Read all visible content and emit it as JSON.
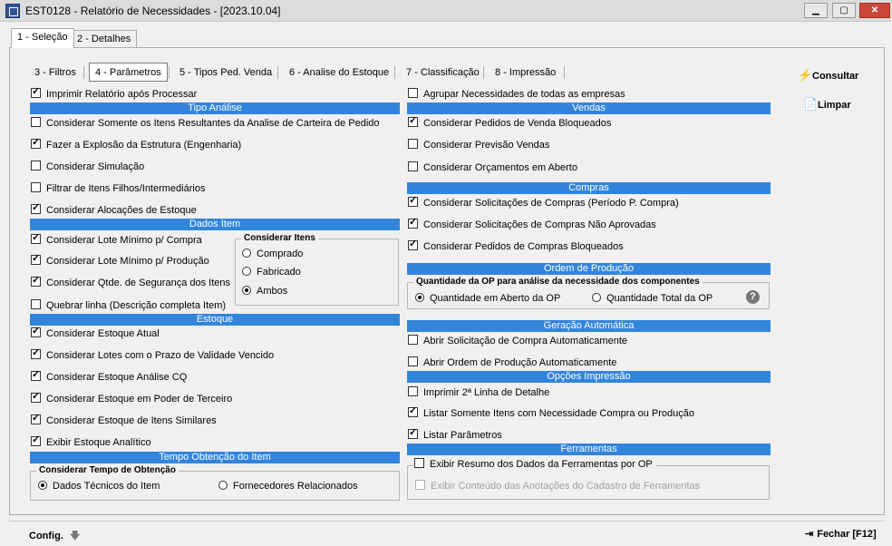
{
  "window": {
    "title": "EST0128 - Relatório de Necessidades - [2023.10.04]",
    "minimize": "▁",
    "maximize": "▢",
    "close": "✕"
  },
  "outer_tabs": [
    "1 - Seleção",
    "2 - Detalhes"
  ],
  "inner_tabs": [
    "3 - Filtros",
    "4 - Parâmetros",
    "5 - Tipos Ped. Venda",
    "6 - Analise do Estoque",
    "7 - Classificação",
    "8 - Impressão"
  ],
  "side_buttons": {
    "consultar": "Consultar",
    "consultar_icon": "⚡",
    "limpar": "Limpar",
    "limpar_icon": "📄"
  },
  "left": {
    "imprimir_relatorio": "Imprimir Relatório após Processar",
    "tipo_analise_header": "Tipo Análise",
    "tipo_analise": [
      "Considerar Somente os Itens Resultantes da Analise de Carteira de Pedido",
      "Fazer a Explosão da Estrutura (Engenharia)",
      "Considerar Simulação",
      "Filtrar de Itens Filhos/Intermediários",
      "Considerar Alocações de Estoque"
    ],
    "dados_item_header": "Dados Item",
    "dados_item": [
      "Considerar Lote Mínimo p/ Compra",
      "Considerar Lote Mínimo p/ Produção",
      "Considerar Qtde. de Segurança dos Itens",
      "Quebrar linha (Descrição completa Item)"
    ],
    "considerar_itens": {
      "title": "Considerar Itens",
      "options": [
        "Comprado",
        "Fabricado",
        "Ambos"
      ],
      "selected": "Ambos"
    },
    "estoque_header": "Estoque",
    "estoque": [
      "Considerar Estoque Atual",
      "Considerar Lotes com o Prazo de Validade Vencido",
      "Considerar Estoque Análise CQ",
      "Considerar Estoque em Poder de Terceiro",
      "Considerar Estoque de Itens Similares",
      "Exibir Estoque Analítico"
    ],
    "tempo_header": "Tempo Obtenção do Item",
    "tempo_group": {
      "title": "Considerar Tempo de Obtenção",
      "options": [
        "Dados Técnicos do Item",
        "Fornecedores Relacionados"
      ],
      "selected": "Dados Técnicos do Item"
    }
  },
  "right": {
    "agrupar": "Agrupar Necessidades de todas as empresas",
    "vendas_header": "Vendas",
    "vendas": [
      "Considerar Pedidos de Venda Bloqueados",
      "Considerar Previsão Vendas",
      "Considerar Orçamentos em Aberto"
    ],
    "compras_header": "Compras",
    "compras": [
      "Considerar Solicitações de Compras (Período P. Compra)",
      "Considerar Solicitações de Compras Não Aprovadas",
      "Considerar Pedidos de Compras Bloqueados"
    ],
    "ordem_header": "Ordem de Produção",
    "ordem_group": {
      "title": "Quantidade da OP para análise da necessidade dos componentes",
      "options": [
        "Quantidade em Aberto da OP",
        "Quantidade Total da OP"
      ],
      "selected": "Quantidade em Aberto da OP",
      "help": "?"
    },
    "geracao_header": "Geração Automática",
    "geracao": [
      "Abrir Solicitação de Compra Automaticamente",
      "Abrir Ordem de Produção Automaticamente"
    ],
    "opcoes_header": "Opções Impressão",
    "opcoes": [
      "Imprimir 2ª Linha de Detalhe",
      "Listar Somente Itens com Necessidade Compra ou Produção",
      "Listar Parâmetros"
    ],
    "ferramentas_header": "Ferramentas",
    "ferramentas_group_title": "Exibir Resumo dos Dados da Ferramentas por OP",
    "ferramentas_sub": "Exibir Conteúdo das Anotações do Cadastro de Ferramentas"
  },
  "footer": {
    "config": "Config.",
    "config_icon": "🡇",
    "fechar": "Fechar [F12]",
    "fechar_icon": "⇥"
  },
  "colors": {
    "section_bar": "#3385db",
    "title_bar": "#dcdcdc",
    "close_button": "#c9483a"
  }
}
